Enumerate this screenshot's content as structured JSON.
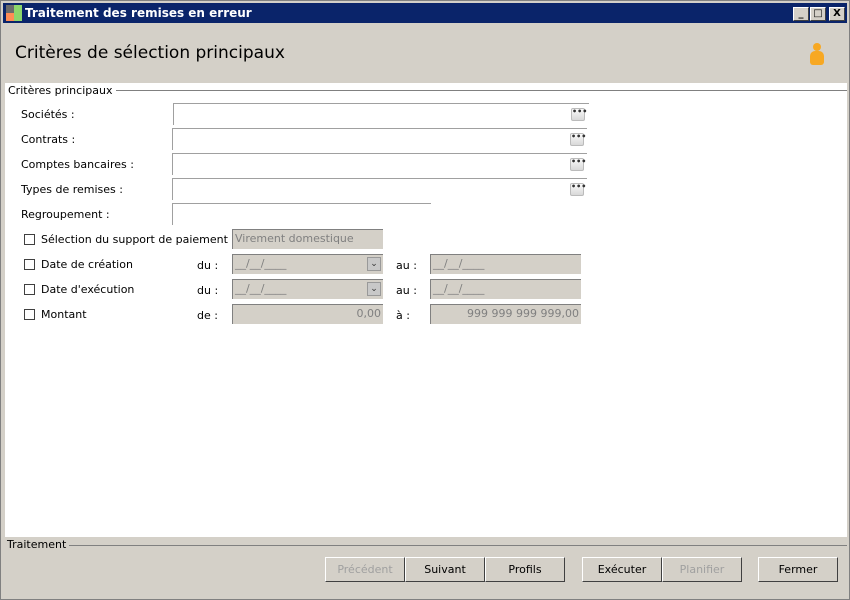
{
  "window": {
    "title": "Traitement des remises en erreur",
    "minimize": "_",
    "maximize": "□",
    "close": "X"
  },
  "header": {
    "title": "Critères de sélection principaux",
    "user_icon": "user-icon"
  },
  "criteria": {
    "section": "Critères principaux",
    "fields": [
      {
        "label": "Sociétés :",
        "value": ""
      },
      {
        "label": "Contrats :",
        "value": ""
      },
      {
        "label": "Comptes bancaires :",
        "value": ""
      },
      {
        "label": "Types de remises :",
        "value": ""
      }
    ],
    "browse": "•••",
    "regroupement": {
      "label": "Regroupement :",
      "value": ""
    },
    "support": {
      "label": "Sélection du support de paiement",
      "value": "Virement domestique",
      "checked": false
    },
    "date_creation": {
      "label": "Date de création",
      "from_label": "du :",
      "from": "__/__/____",
      "to_label": "au :",
      "to": "__/__/____",
      "checked": false
    },
    "date_execution": {
      "label": "Date d'exécution",
      "from_label": "du :",
      "from": "__/__/____",
      "to_label": "au :",
      "to": "__/__/____",
      "checked": false
    },
    "montant": {
      "label": "Montant",
      "from_label": "de :",
      "from": "0,00",
      "to_label": "à :",
      "to": "999 999 999 999,00",
      "checked": false
    },
    "dropdown_glyph": "⌄"
  },
  "footer": {
    "section": "Traitement",
    "buttons": {
      "previous": "Précédent",
      "next": "Suivant",
      "profiles": "Profils",
      "execute": "Exécuter",
      "schedule": "Planifier",
      "close": "Fermer"
    }
  }
}
